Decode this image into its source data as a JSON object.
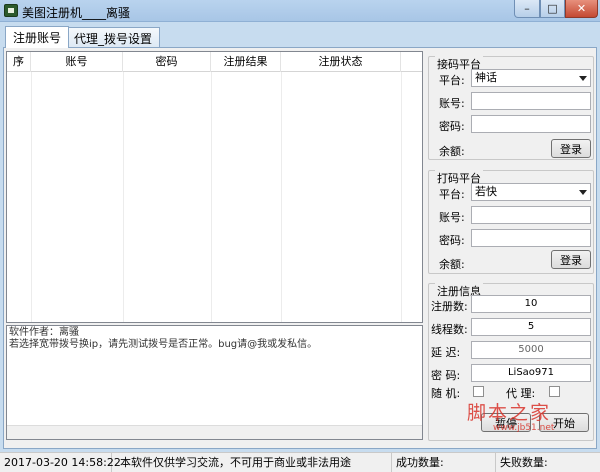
{
  "window": {
    "title": "美图注册机____离骚",
    "min_glyph": "–",
    "max_glyph": "□",
    "close_glyph": "✕"
  },
  "tabs": [
    {
      "label": "注册账号",
      "active": true
    },
    {
      "label": "代理_拨号设置",
      "active": false
    }
  ],
  "table": {
    "columns": [
      "序",
      "账号",
      "密码",
      "注册结果",
      "注册状态"
    ],
    "rows": []
  },
  "log": {
    "lines": [
      "软件作者：离骚",
      "若选择宽带拨号换ip，请先测试拨号是否正常。bug请@我或发私信。"
    ]
  },
  "receive_platform": {
    "title": "接码平台",
    "platform_label": "平台:",
    "platform_value": "神话",
    "account_label": "账号:",
    "account_value": "",
    "password_label": "密码:",
    "password_value": "",
    "balance_label": "余额:",
    "login_label": "登录"
  },
  "captcha_platform": {
    "title": "打码平台",
    "platform_label": "平台:",
    "platform_value": "若快",
    "account_label": "账号:",
    "account_value": "",
    "password_label": "密码:",
    "password_value": "",
    "balance_label": "余额:",
    "login_label": "登录"
  },
  "register_info": {
    "title": "注册信息",
    "count_label": "注册数:",
    "count_value": "10",
    "threads_label": "线程数:",
    "threads_value": "5",
    "delay_label": "延  迟:",
    "delay_value": "5000",
    "password_label": "密  码:",
    "password_value": "LiSao971",
    "random_label": "随  机:",
    "random_checked": false,
    "proxy_label": "代  理:",
    "proxy_checked": false,
    "pause_label": "暂停",
    "start_label": "开始"
  },
  "statusbar": {
    "datetime": "2017-03-20 14:58:22",
    "notice": "本软件仅供学习交流，不可用于商业或非法用途",
    "success_label": "成功数量:",
    "fail_label": "失败数量:"
  },
  "watermark": {
    "main": "脚本之家",
    "sub": "www.jb51.net"
  }
}
